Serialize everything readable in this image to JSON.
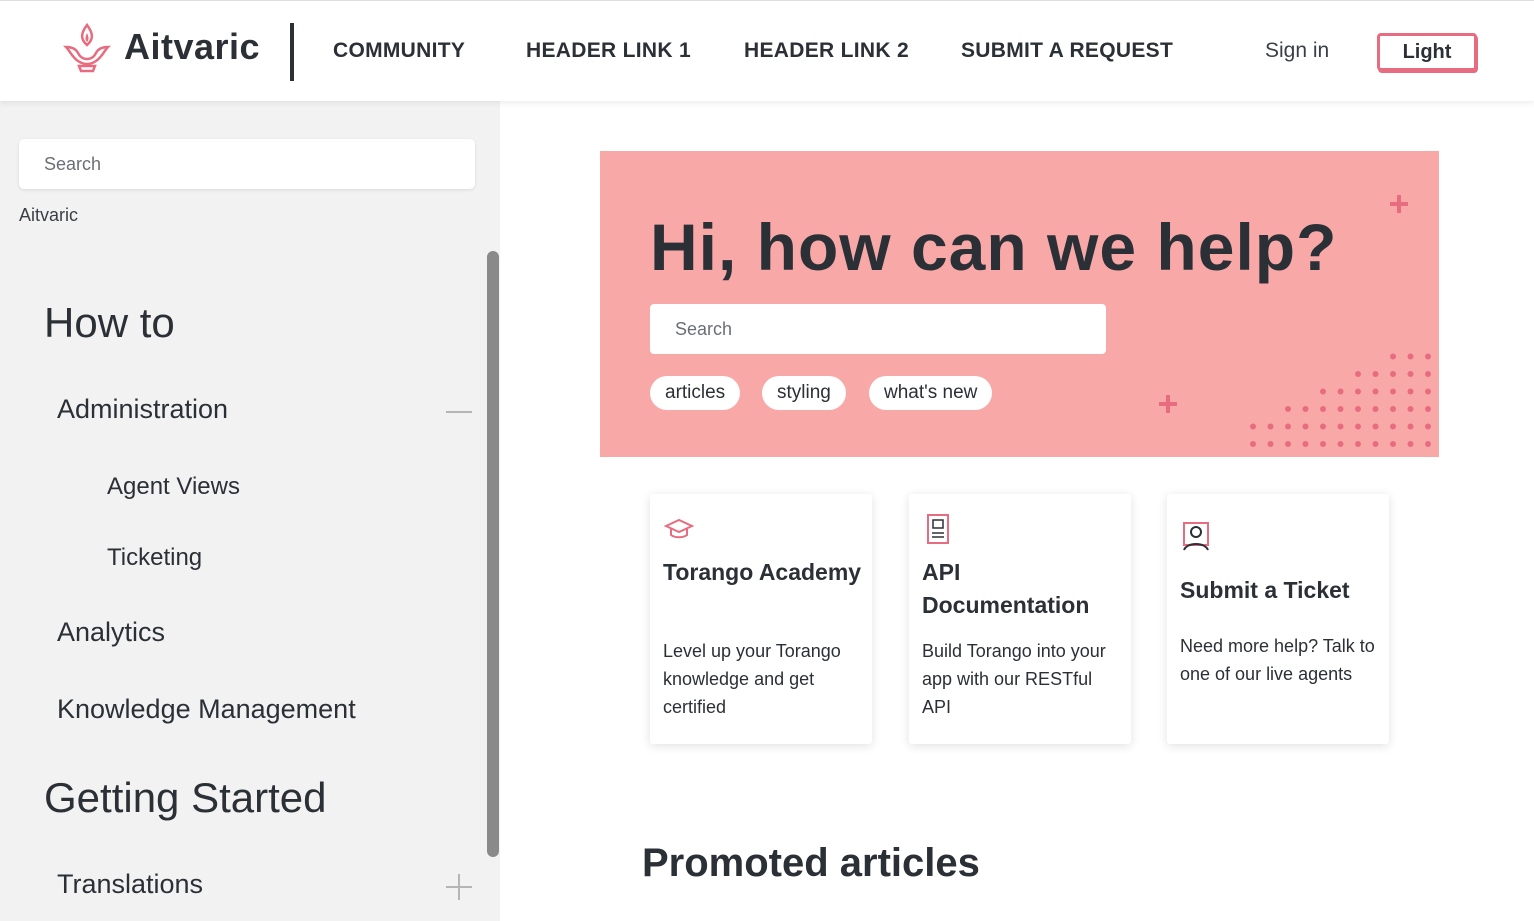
{
  "brand": {
    "name": "Aitvaric",
    "accent": "#e86c7f",
    "hero_bg": "#f9a8a8"
  },
  "header": {
    "nav": [
      "COMMUNITY",
      "HEADER LINK 1",
      "HEADER LINK 2",
      "SUBMIT A REQUEST"
    ],
    "signin": "Sign in",
    "theme_toggle": "Light"
  },
  "sidebar": {
    "search_placeholder": "Search",
    "breadcrumb": "Aitvaric",
    "sections": [
      {
        "title": "How to",
        "items": [
          {
            "label": "Administration",
            "expanded": true,
            "icon": "minus-icon",
            "children": [
              "Agent Views",
              "Ticketing"
            ]
          },
          {
            "label": "Analytics"
          },
          {
            "label": "Knowledge Management"
          }
        ]
      },
      {
        "title": "Getting Started",
        "items": [
          {
            "label": "Translations",
            "expanded": false,
            "icon": "plus-icon"
          }
        ]
      }
    ]
  },
  "hero": {
    "title": "Hi, how can we help?",
    "search_placeholder": "Search",
    "tags": [
      "articles",
      "styling",
      "what's new"
    ]
  },
  "cards": [
    {
      "icon": "graduation-cap-icon",
      "title": "Torango Academy",
      "desc": "Level up your Torango knowledge and get certified"
    },
    {
      "icon": "document-icon",
      "title": "API Documentation",
      "desc": "Build Torango into your app with our RESTful API"
    },
    {
      "icon": "support-agent-icon",
      "title": "Submit a Ticket",
      "desc": "Need more help? Talk to one of our live agents"
    }
  ],
  "promoted": {
    "title": "Promoted articles"
  }
}
